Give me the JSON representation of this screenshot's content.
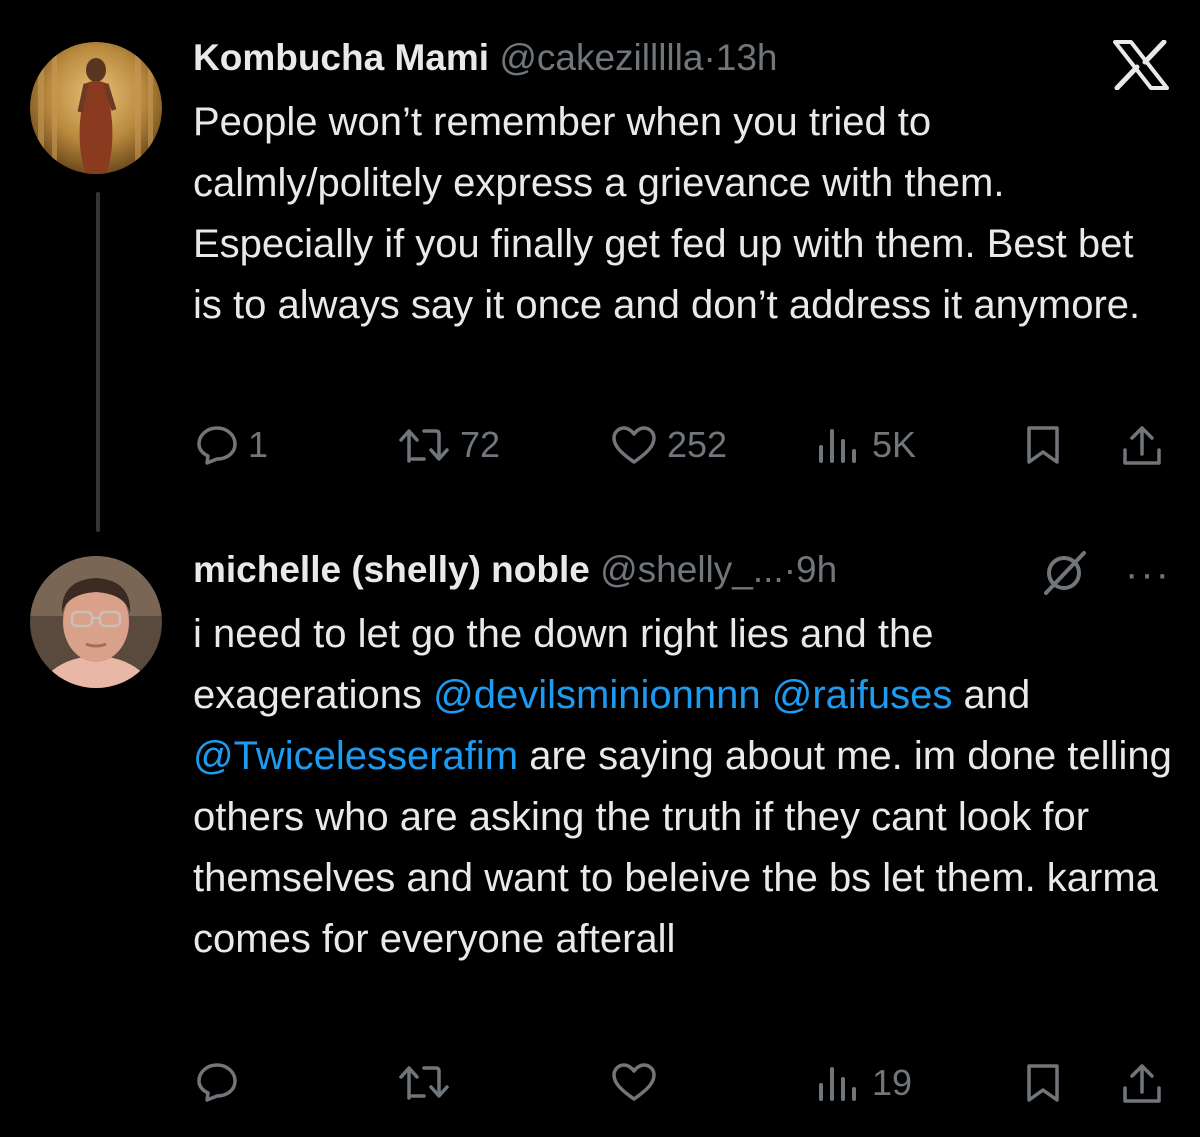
{
  "tweet1": {
    "name": "Kombucha Mami",
    "handle": "@cakezillllla",
    "separator": "·",
    "time": "13h",
    "text": "People won’t remember when you tried to calmly/politely express a grievance with them. Especially if you finally get fed up with them. Best bet is to always say it once and don’t address it anymore.",
    "replies": "1",
    "reposts": "72",
    "likes": "252",
    "views": "5K"
  },
  "tweet2": {
    "name": "michelle (shelly) noble",
    "handle": "@shelly_...",
    "separator": "·",
    "time": "9h",
    "text_parts": {
      "t1": "i need to let go the down right lies and the exagerations ",
      "m1": "@devilsminionnnn",
      "t2": " ",
      "m2": "@raifuses",
      "t3": " and ",
      "m3": "@Twicelesserafim",
      "t4": " are saying about me. im done telling others who are asking the truth if they cant look for themselves and want to beleive the bs let them. karma comes for everyone afterall"
    },
    "views": "19",
    "more_label": "···"
  },
  "icons": {
    "reply": "reply-icon",
    "repost": "repost-icon",
    "like": "heart-icon",
    "views": "views-icon",
    "bookmark": "bookmark-icon",
    "share": "share-icon",
    "x": "x-logo-icon",
    "grok": "grok-icon"
  },
  "colors": {
    "background": "#000000",
    "text": "#e7e9ea",
    "muted": "#71767b",
    "link": "#1d9bf0"
  }
}
